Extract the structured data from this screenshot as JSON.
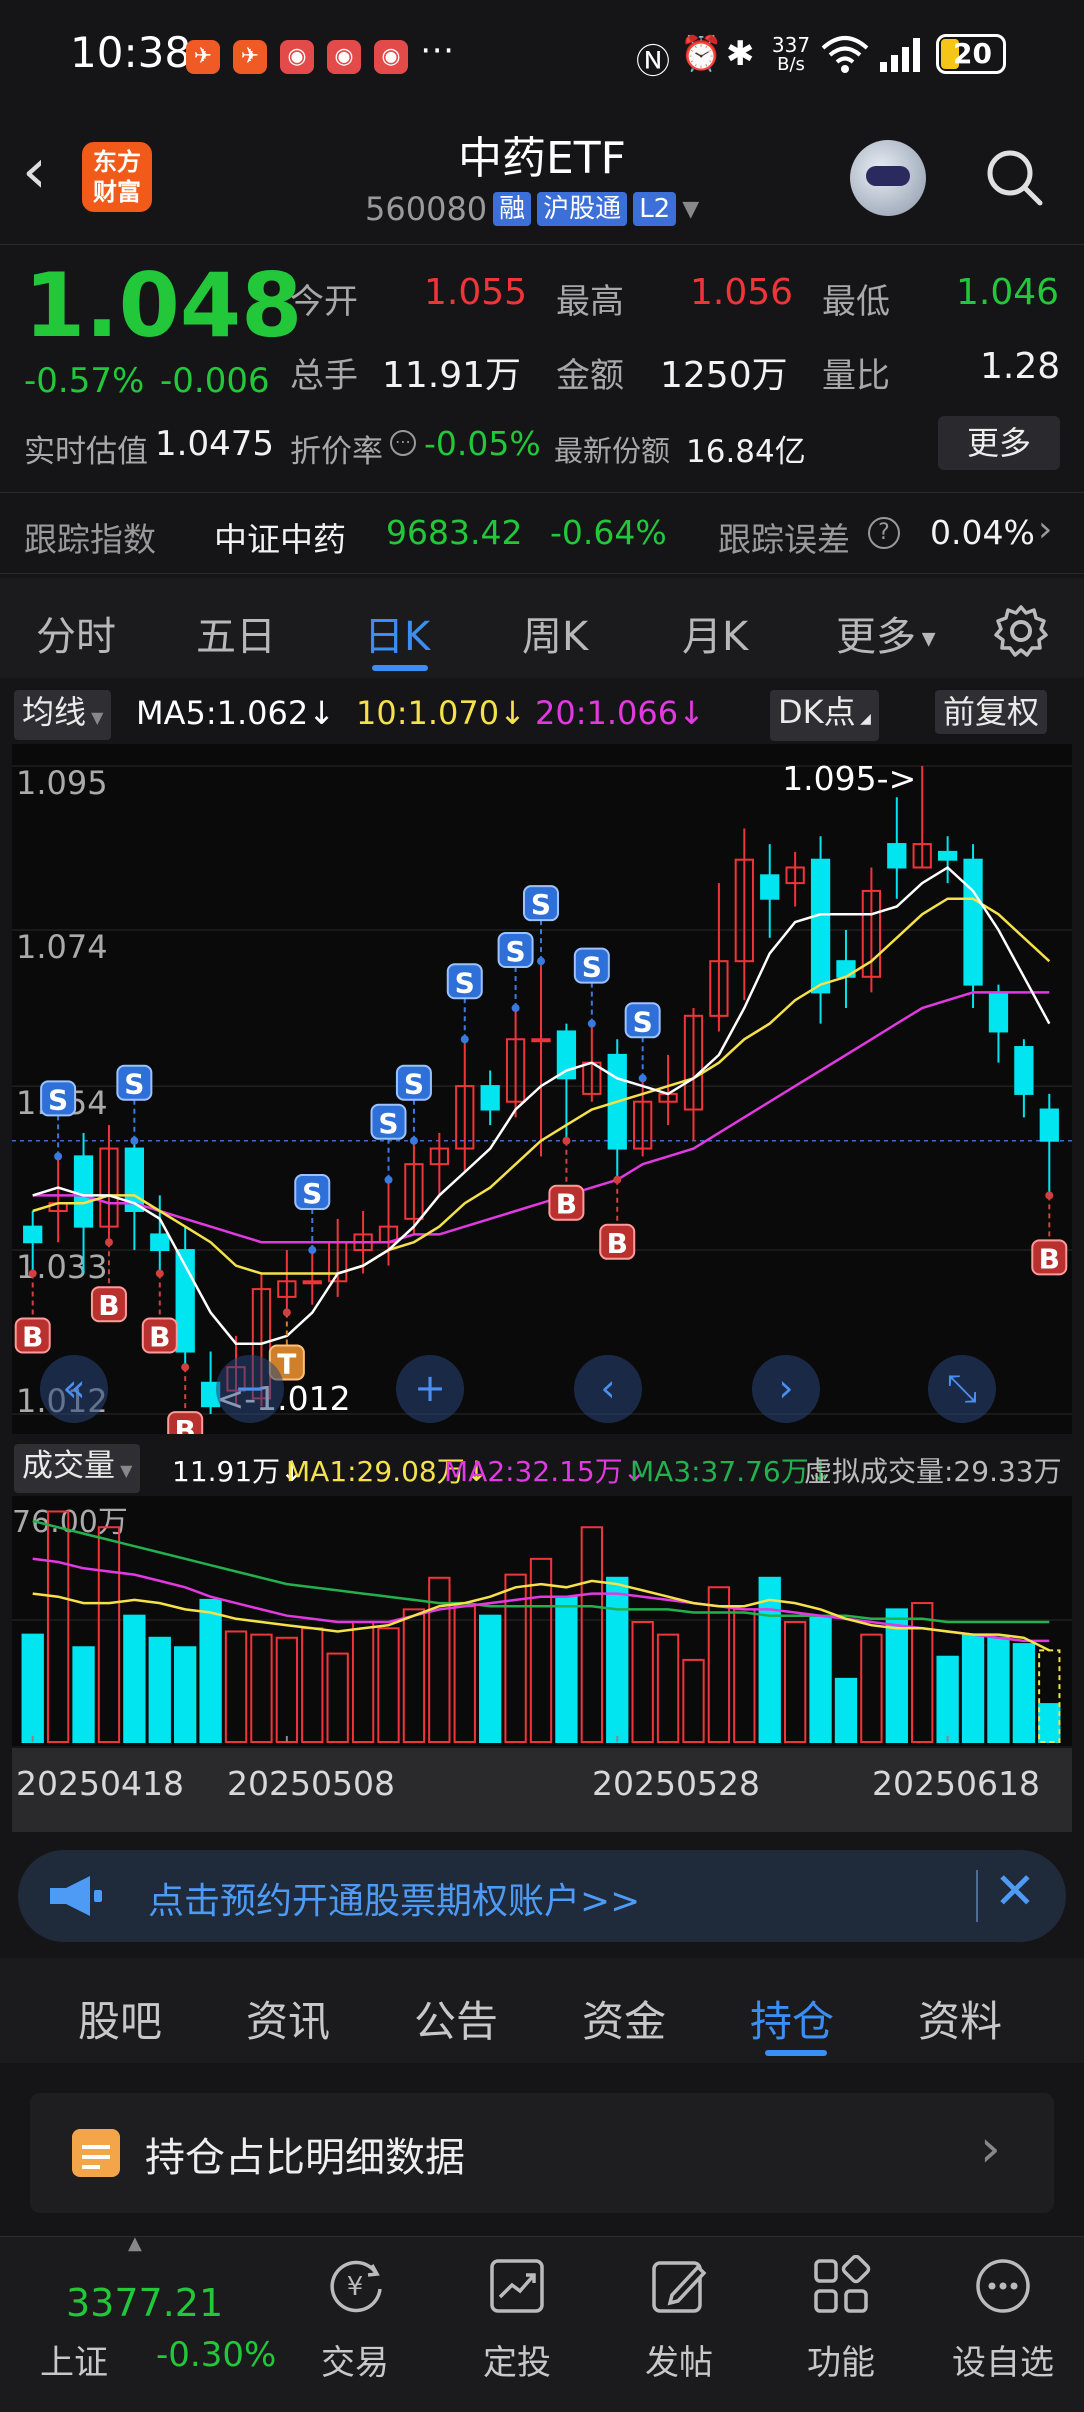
{
  "status_bar": {
    "time": "10:38",
    "network_speed_value": "337",
    "network_speed_unit": "B/s",
    "battery": "20"
  },
  "header": {
    "back_icon": "chevron-left-icon",
    "broker_logo_line1": "东方",
    "broker_logo_line2": "财富",
    "title": "中药ETF",
    "code": "560080",
    "tags": [
      "融",
      "沪股通",
      "L2"
    ],
    "search_icon": "search-icon"
  },
  "quote": {
    "price": "1.048",
    "change_pct": "-0.57%",
    "change_abs": "-0.006",
    "fields": {
      "open_label": "今开",
      "open_value": "1.055",
      "high_label": "最高",
      "high_value": "1.056",
      "low_label": "最低",
      "low_value": "1.046",
      "volume_label": "总手",
      "volume_value": "11.91万",
      "amount_label": "金额",
      "amount_value": "1250万",
      "ratio_label": "量比",
      "ratio_value": "1.28",
      "iopv_label": "实时估值",
      "iopv_value": "1.0475",
      "premium_label": "折价率",
      "premium_value": "-0.05%",
      "shares_label": "最新份额",
      "shares_value": "16.84亿"
    },
    "more_button": "更多"
  },
  "tracking": {
    "label": "跟踪指数",
    "index_name": "中证中药",
    "index_value": "9683.42",
    "index_change": "-0.64%",
    "error_label": "跟踪误差",
    "error_value": "0.04%"
  },
  "period_tabs": [
    "分时",
    "五日",
    "日K",
    "周K",
    "月K",
    "更多"
  ],
  "period_active": "日K",
  "ma_legend": {
    "selector": "均线",
    "ma5": "MA5:1.062",
    "ma10": "10:1.070",
    "ma20": "20:1.066",
    "dk_button": "DK点",
    "adjust_button": "前复权"
  },
  "colors": {
    "up": "#f0353a",
    "down": "#00e5f0",
    "ma5": "#ffffff",
    "ma10": "#f5e14a",
    "ma20": "#e03ae0",
    "vol_ma3": "#22b14c",
    "accent": "#3a8ef5"
  },
  "chart_data": {
    "type": "candlestick",
    "ylim": [
      1.012,
      1.095
    ],
    "y_ticks": [
      "1.095",
      "1.074",
      "1.054",
      "1.033",
      "1.012"
    ],
    "max_label": "1.095->",
    "min_label": "<-1.012",
    "candles": [
      [
        1.036,
        1.034,
        1.038,
        1.03
      ],
      [
        1.038,
        1.039,
        1.045,
        1.034
      ],
      [
        1.045,
        1.036,
        1.048,
        1.03
      ],
      [
        1.036,
        1.046,
        1.049,
        1.034
      ],
      [
        1.046,
        1.038,
        1.047,
        1.033
      ],
      [
        1.035,
        1.033,
        1.04,
        1.03
      ],
      [
        1.033,
        1.02,
        1.036,
        1.018
      ],
      [
        1.016,
        1.013,
        1.02,
        1.012
      ],
      [
        1.015,
        1.018,
        1.022,
        1.013
      ],
      [
        1.014,
        1.028,
        1.03,
        1.013
      ],
      [
        1.027,
        1.029,
        1.033,
        1.025
      ],
      [
        1.029,
        1.029,
        1.033,
        1.026
      ],
      [
        1.029,
        1.034,
        1.037,
        1.027
      ],
      [
        1.033,
        1.035,
        1.038,
        1.03
      ],
      [
        1.034,
        1.036,
        1.042,
        1.031
      ],
      [
        1.037,
        1.044,
        1.047,
        1.035
      ],
      [
        1.044,
        1.046,
        1.048,
        1.04
      ],
      [
        1.046,
        1.054,
        1.06,
        1.043
      ],
      [
        1.054,
        1.051,
        1.056,
        1.049
      ],
      [
        1.052,
        1.06,
        1.064,
        1.05
      ],
      [
        1.06,
        1.06,
        1.07,
        1.045
      ],
      [
        1.061,
        1.055,
        1.062,
        1.047
      ],
      [
        1.053,
        1.057,
        1.062,
        1.052
      ],
      [
        1.058,
        1.046,
        1.06,
        1.042
      ],
      [
        1.046,
        1.052,
        1.055,
        1.045
      ],
      [
        1.052,
        1.053,
        1.058,
        1.049
      ],
      [
        1.051,
        1.063,
        1.064,
        1.047
      ],
      [
        1.063,
        1.07,
        1.08,
        1.061
      ],
      [
        1.07,
        1.083,
        1.087,
        1.065
      ],
      [
        1.081,
        1.078,
        1.085,
        1.073
      ],
      [
        1.08,
        1.082,
        1.084,
        1.077
      ],
      [
        1.083,
        1.066,
        1.086,
        1.062
      ],
      [
        1.07,
        1.068,
        1.074,
        1.064
      ],
      [
        1.068,
        1.079,
        1.082,
        1.066
      ],
      [
        1.085,
        1.082,
        1.091,
        1.078
      ],
      [
        1.082,
        1.085,
        1.095,
        1.082
      ],
      [
        1.084,
        1.083,
        1.086,
        1.08
      ],
      [
        1.083,
        1.067,
        1.085,
        1.064
      ],
      [
        1.066,
        1.061,
        1.067,
        1.057
      ],
      [
        1.059,
        1.053,
        1.06,
        1.05
      ],
      [
        1.051,
        1.047,
        1.053,
        1.04
      ]
    ],
    "ma5": [
      1.04,
      1.041,
      1.04,
      1.04,
      1.039,
      1.037,
      1.031,
      1.025,
      1.021,
      1.021,
      1.022,
      1.025,
      1.03,
      1.031,
      1.033,
      1.036,
      1.04,
      1.043,
      1.046,
      1.051,
      1.054,
      1.056,
      1.057,
      1.055,
      1.054,
      1.053,
      1.055,
      1.058,
      1.064,
      1.071,
      1.075,
      1.076,
      1.076,
      1.076,
      1.077,
      1.08,
      1.082,
      1.079,
      1.074,
      1.068,
      1.062
    ],
    "ma10": [
      1.038,
      1.039,
      1.039,
      1.04,
      1.04,
      1.038,
      1.036,
      1.034,
      1.031,
      1.03,
      1.03,
      1.03,
      1.03,
      1.031,
      1.033,
      1.034,
      1.036,
      1.039,
      1.041,
      1.044,
      1.047,
      1.049,
      1.051,
      1.052,
      1.053,
      1.054,
      1.055,
      1.057,
      1.06,
      1.062,
      1.065,
      1.067,
      1.068,
      1.07,
      1.073,
      1.076,
      1.078,
      1.078,
      1.076,
      1.073,
      1.07
    ],
    "ma20": [
      1.04,
      1.04,
      1.04,
      1.039,
      1.039,
      1.038,
      1.037,
      1.036,
      1.035,
      1.034,
      1.034,
      1.034,
      1.034,
      1.034,
      1.034,
      1.035,
      1.035,
      1.036,
      1.037,
      1.038,
      1.039,
      1.04,
      1.041,
      1.042,
      1.044,
      1.045,
      1.046,
      1.048,
      1.05,
      1.052,
      1.054,
      1.056,
      1.058,
      1.06,
      1.062,
      1.064,
      1.065,
      1.066,
      1.066,
      1.066,
      1.066
    ],
    "signals": [
      {
        "i": 0,
        "t": "B"
      },
      {
        "i": 1,
        "t": "S"
      },
      {
        "i": 3,
        "t": "B"
      },
      {
        "i": 4,
        "t": "S"
      },
      {
        "i": 5,
        "t": "B"
      },
      {
        "i": 6,
        "t": "B"
      },
      {
        "i": 10,
        "t": "T"
      },
      {
        "i": 11,
        "t": "S"
      },
      {
        "i": 14,
        "t": "S"
      },
      {
        "i": 15,
        "t": "S"
      },
      {
        "i": 17,
        "t": "S"
      },
      {
        "i": 19,
        "t": "S"
      },
      {
        "i": 20,
        "t": "S"
      },
      {
        "i": 21,
        "t": "B"
      },
      {
        "i": 22,
        "t": "S"
      },
      {
        "i": 23,
        "t": "B"
      },
      {
        "i": 24,
        "t": "S"
      },
      {
        "i": 40,
        "t": "B"
      }
    ],
    "x_labels": [
      "20250418",
      "20250508",
      "20250528",
      "20250618"
    ]
  },
  "volume_legend": {
    "selector": "成交量",
    "vol": "11.91万",
    "ma1": "MA1:29.08万",
    "ma2": "MA2:32.15万",
    "ma3": "MA3:37.76万",
    "virtual": "虚拟成交量:29.33万",
    "axis_max": "76.00万"
  },
  "volume_data": {
    "ymax": 76,
    "values": [
      34,
      73,
      30,
      68,
      40,
      33,
      30,
      45,
      35,
      34,
      33,
      36,
      28,
      38,
      36,
      42,
      52,
      43,
      40,
      53,
      58,
      46,
      68,
      52,
      38,
      34,
      26,
      49,
      42,
      52,
      38,
      40,
      20,
      34,
      42,
      44,
      27,
      34,
      33,
      31,
      12
    ],
    "ma1": [
      47,
      46,
      44,
      44,
      45,
      44,
      42,
      41,
      39,
      38,
      37,
      36,
      35,
      36,
      37,
      40,
      43,
      44,
      46,
      49,
      50,
      49,
      51,
      50,
      48,
      46,
      44,
      43,
      43,
      45,
      44,
      42,
      39,
      37,
      36,
      36,
      35,
      34,
      34,
      33,
      29
    ],
    "ma2": [
      58,
      57,
      55,
      54,
      53,
      51,
      49,
      46,
      44,
      42,
      40,
      39,
      38,
      38,
      38,
      40,
      42,
      43,
      44,
      45,
      46,
      46,
      47,
      47,
      46,
      45,
      44,
      43,
      42,
      42,
      41,
      40,
      39,
      38,
      37,
      36,
      35,
      34,
      33,
      32,
      32
    ],
    "ma3": [
      70,
      68,
      66,
      64,
      62,
      60,
      58,
      56,
      54,
      52,
      50,
      49,
      48,
      47,
      46,
      45,
      44,
      44,
      43,
      43,
      43,
      43,
      43,
      42,
      42,
      42,
      41,
      41,
      41,
      40,
      40,
      40,
      40,
      39,
      39,
      39,
      38,
      38,
      38,
      38,
      38
    ]
  },
  "banner": {
    "text": "点击预约开通股票期权账户>>",
    "icon": "megaphone-icon"
  },
  "content_tabs": [
    "股吧",
    "资讯",
    "公告",
    "资金",
    "持仓",
    "资料"
  ],
  "content_active": "持仓",
  "detail_card": {
    "title": "持仓占比明细数据",
    "icon": "calendar-icon"
  },
  "bottom_nav": {
    "index_value": "3377.21",
    "index_name": "上证",
    "index_change": "-0.30%",
    "items": [
      {
        "label": "交易",
        "icon": "trade-icon"
      },
      {
        "label": "定投",
        "icon": "chart-icon"
      },
      {
        "label": "发帖",
        "icon": "edit-icon"
      },
      {
        "label": "功能",
        "icon": "grid-icon"
      },
      {
        "label": "设自选",
        "icon": "more-icon"
      }
    ]
  }
}
